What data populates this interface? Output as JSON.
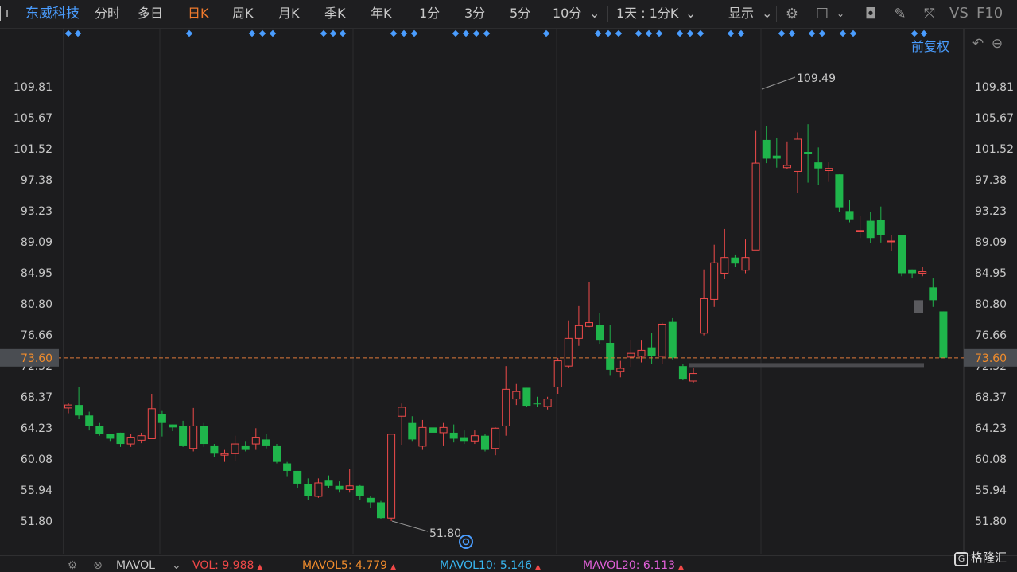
{
  "toolbar": {
    "stock_name": "东威科技",
    "periods": [
      "分时",
      "多日",
      "日K",
      "周K",
      "月K",
      "季K",
      "年K",
      "1分",
      "3分",
      "5分",
      "10分"
    ],
    "active_period": "日K",
    "interval_select": "1天 : 1分K",
    "display_label": "显示",
    "vs_label": "VS",
    "f10_label": "F10"
  },
  "subbar": {
    "adjust_label": "前复权"
  },
  "chart_data": {
    "type": "candlestick",
    "y_ticks": [
      "109.81",
      "105.67",
      "101.52",
      "97.38",
      "93.23",
      "89.09",
      "84.95",
      "80.80",
      "76.66",
      "72.52",
      "68.37",
      "64.23",
      "60.08",
      "55.94",
      "51.80"
    ],
    "current_price": "73.60",
    "high_label": "109.49",
    "low_label": "51.80",
    "ylim": [
      51.8,
      109.81
    ],
    "up_color": "#f04a4a",
    "down_color": "#1fb54b",
    "candles": [
      [
        66.9,
        67.3,
        66.2,
        67.6
      ],
      [
        67.3,
        65.9,
        65.4,
        69.7
      ],
      [
        65.9,
        64.5,
        63.9,
        66.4
      ],
      [
        64.5,
        63.4,
        63.2,
        64.9
      ],
      [
        63.4,
        62.8,
        62.5,
        63.4
      ],
      [
        63.6,
        62.1,
        61.7,
        63.6
      ],
      [
        62.1,
        63.0,
        61.7,
        63.4
      ],
      [
        62.6,
        63.2,
        62.2,
        63.6
      ],
      [
        62.8,
        66.8,
        62.8,
        68.8
      ],
      [
        66.1,
        64.9,
        63.1,
        66.6
      ],
      [
        64.7,
        64.3,
        63.8,
        64.7
      ],
      [
        64.5,
        61.9,
        61.7,
        65.2
      ],
      [
        61.5,
        64.5,
        61.1,
        66.9
      ],
      [
        64.5,
        62.1,
        61.7,
        64.9
      ],
      [
        61.9,
        60.8,
        60.4,
        62.1
      ],
      [
        60.6,
        60.8,
        59.7,
        61.3
      ],
      [
        60.8,
        62.1,
        59.8,
        63.2
      ],
      [
        61.9,
        61.3,
        61.1,
        62.5
      ],
      [
        62.1,
        63.0,
        61.3,
        64.2
      ],
      [
        62.7,
        61.9,
        61.5,
        63.4
      ],
      [
        61.9,
        59.7,
        59.5,
        62.1
      ],
      [
        59.5,
        58.5,
        57.8,
        59.7
      ],
      [
        58.5,
        56.8,
        56.2,
        58.5
      ],
      [
        56.7,
        55.1,
        54.6,
        57.5
      ],
      [
        55.1,
        56.9,
        54.9,
        57.5
      ],
      [
        57.3,
        56.5,
        56.2,
        57.9
      ],
      [
        56.5,
        56.0,
        55.6,
        57.1
      ],
      [
        56.0,
        56.5,
        55.6,
        58.8
      ],
      [
        56.5,
        55.1,
        54.6,
        56.6
      ],
      [
        54.9,
        54.3,
        53.6,
        55.1
      ],
      [
        54.3,
        52.2,
        52.1,
        54.5
      ],
      [
        52.2,
        63.4,
        51.8,
        63.4
      ],
      [
        65.8,
        67.0,
        62.0,
        67.5
      ],
      [
        64.9,
        62.7,
        62.5,
        65.8
      ],
      [
        61.8,
        64.3,
        61.3,
        65.3
      ],
      [
        64.3,
        63.6,
        63.2,
        68.8
      ],
      [
        63.6,
        64.3,
        61.9,
        64.9
      ],
      [
        63.6,
        62.8,
        62.3,
        64.7
      ],
      [
        63.0,
        62.5,
        62.1,
        63.9
      ],
      [
        62.5,
        63.2,
        62.1,
        63.9
      ],
      [
        63.2,
        61.3,
        61.1,
        63.4
      ],
      [
        61.5,
        64.2,
        60.6,
        64.3
      ],
      [
        64.5,
        69.4,
        63.2,
        72.5
      ],
      [
        68.1,
        69.1,
        67.3,
        70.1
      ],
      [
        69.6,
        67.2,
        67.0,
        69.6
      ],
      [
        67.5,
        67.4,
        67.1,
        68.4
      ],
      [
        67.1,
        68.1,
        66.7,
        68.4
      ],
      [
        69.7,
        73.2,
        68.8,
        73.6
      ],
      [
        72.5,
        76.2,
        72.2,
        78.6
      ],
      [
        76.2,
        77.9,
        75.2,
        80.5
      ],
      [
        77.8,
        78.3,
        77.7,
        83.7
      ],
      [
        78.0,
        75.9,
        75.4,
        79.6
      ],
      [
        75.6,
        72.0,
        71.2,
        78.0
      ],
      [
        71.8,
        72.2,
        71.0,
        73.2
      ],
      [
        73.7,
        74.2,
        72.4,
        76.0
      ],
      [
        73.8,
        74.6,
        73.0,
        75.9
      ],
      [
        75.0,
        73.8,
        72.8,
        76.9
      ],
      [
        73.8,
        78.1,
        72.8,
        78.3
      ],
      [
        78.4,
        73.6,
        73.4,
        78.9
      ],
      [
        72.5,
        70.7,
        70.6,
        72.8
      ],
      [
        70.5,
        71.5,
        70.3,
        72.2
      ],
      [
        76.9,
        81.5,
        76.6,
        85.4
      ],
      [
        81.4,
        86.3,
        80.4,
        88.7
      ],
      [
        84.9,
        87.0,
        84.1,
        90.8
      ],
      [
        87.0,
        86.2,
        85.7,
        87.4
      ],
      [
        85.3,
        87.0,
        84.9,
        89.4
      ],
      [
        88.0,
        99.6,
        88.0,
        103.9
      ],
      [
        102.7,
        100.2,
        99.6,
        104.6
      ],
      [
        100.6,
        100.2,
        99.0,
        103.0
      ],
      [
        99.0,
        99.3,
        98.8,
        102.5
      ],
      [
        98.5,
        102.8,
        95.6,
        103.7
      ],
      [
        101.1,
        100.8,
        97.0,
        104.8
      ],
      [
        99.7,
        98.9,
        96.7,
        101.7
      ],
      [
        98.6,
        98.9,
        97.1,
        99.7
      ],
      [
        98.1,
        93.7,
        93.1,
        98.1
      ],
      [
        93.2,
        92.1,
        91.7,
        94.7
      ],
      [
        90.5,
        90.6,
        89.6,
        92.5
      ],
      [
        91.9,
        89.6,
        88.9,
        93.1
      ],
      [
        92.0,
        90.0,
        89.0,
        93.8
      ],
      [
        89.2,
        89.2,
        87.9,
        90.0
      ],
      [
        90.0,
        84.9,
        84.5,
        90.0
      ],
      [
        85.4,
        84.9,
        84.2,
        85.4
      ],
      [
        84.9,
        85.1,
        84.5,
        85.7
      ],
      [
        83.0,
        81.3,
        80.4,
        84.2
      ],
      [
        79.8,
        73.6,
        73.6,
        79.8
      ]
    ]
  },
  "indicators": {
    "name": "MAVOL",
    "vol_label": "VOL:",
    "vol_value": "9.988",
    "mavol5_label": "MAVOL5:",
    "mavol5_value": "4.779",
    "mavol10_label": "MAVOL10:",
    "mavol10_value": "5.146",
    "mavol20_label": "MAVOL20:",
    "mavol20_value": "6.113"
  },
  "colors": {
    "vol": "#f04848",
    "mavol5": "#f08c2c",
    "mavol10": "#38b6f0",
    "mavol20": "#e060d8"
  },
  "watermark": "格隆汇"
}
